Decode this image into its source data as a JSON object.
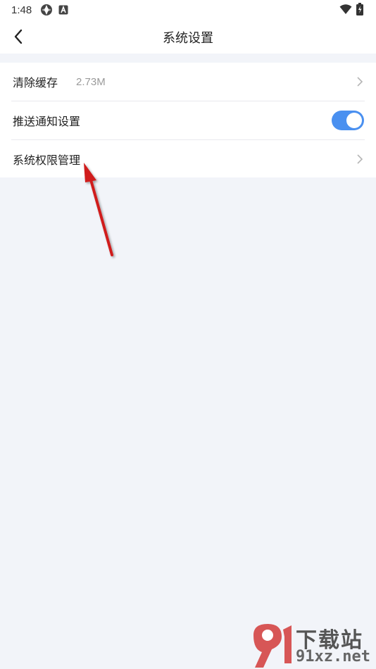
{
  "status_bar": {
    "time": "1:48"
  },
  "header": {
    "title": "系统设置"
  },
  "settings": {
    "items": [
      {
        "label": "清除缓存",
        "value": "2.73M",
        "control": "chevron"
      },
      {
        "label": "推送通知设置",
        "control": "toggle",
        "enabled": true
      },
      {
        "label": "系统权限管理",
        "control": "chevron"
      }
    ]
  },
  "colors": {
    "accent": "#4a90f0",
    "background": "#f2f4f9",
    "annotation_arrow": "#d01e1e"
  },
  "watermark": {
    "brand_cn": "下载站",
    "url": "91xz.net"
  }
}
